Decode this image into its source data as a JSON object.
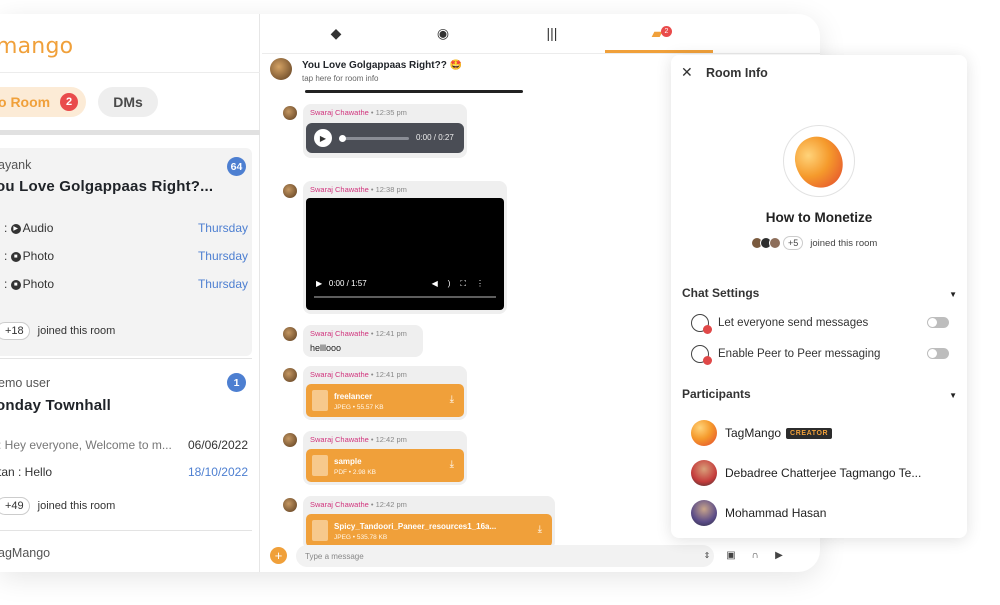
{
  "brand": {
    "logo_text": "mango"
  },
  "tabs": {
    "room_label": "o Room",
    "room_badge": "2",
    "dm_label": "DMs"
  },
  "top_nav": {
    "notification_count": "2"
  },
  "rooms": [
    {
      "sender": "ayank",
      "title": "ou Love Golgappaas Right?...",
      "unread": "64",
      "items": [
        {
          "prefix": "j : ",
          "type": "Audio",
          "date": "Thursday"
        },
        {
          "prefix": "j : ",
          "type": "Photo",
          "date": "Thursday"
        },
        {
          "prefix": "j : ",
          "type": "Photo",
          "date": "Thursday"
        }
      ],
      "joined_count": "+18",
      "joined_text": "joined this room"
    },
    {
      "sender": "emo user",
      "title": "onday Townhall",
      "unread": "1",
      "items": [
        {
          "text": ": Hey everyone, Welcome to m...",
          "date": "06/06/2022"
        },
        {
          "text": "tan : Hello",
          "date": "18/10/2022"
        }
      ],
      "joined_count": "+49",
      "joined_text": "joined this room"
    },
    {
      "sender": "agMango"
    }
  ],
  "chat": {
    "title": "You Love Golgappaas Right??",
    "title_emoji": "🤩",
    "subtitle": "tap here for room info",
    "messages": [
      {
        "sender": "Swaraj Chawathe",
        "time": "12:35 pm",
        "kind": "audio",
        "audio_time": "0:00 / 0:27"
      },
      {
        "sender": "Swaraj Chawathe",
        "time": "12:38 pm",
        "kind": "video",
        "video_time": "0:00 / 1:57"
      },
      {
        "sender": "Swaraj Chawathe",
        "time": "12:41 pm",
        "kind": "text",
        "text": "helllooo"
      },
      {
        "sender": "Swaraj Chawathe",
        "time": "12:41 pm",
        "kind": "file",
        "file_name": "freelancer",
        "file_meta": "JPEG  •  55.57 KB"
      },
      {
        "sender": "Swaraj Chawathe",
        "time": "12:42 pm",
        "kind": "file",
        "file_name": "sample",
        "file_meta": "PDF  •  2.98 KB"
      },
      {
        "sender": "Swaraj Chawathe",
        "time": "12:42 pm",
        "kind": "file",
        "file_name": "Spicy_Tandoori_Paneer_resources1_16a...",
        "file_meta": "JPEG  •  535.78 KB"
      }
    ],
    "input_placeholder": "Type a message"
  },
  "room_info": {
    "header": "Room Info",
    "room_name": "How to Monetize",
    "joined_count": "+5",
    "joined_text": "joined this room",
    "settings_title": "Chat Settings",
    "settings": [
      {
        "label": "Let everyone send messages",
        "enabled": false
      },
      {
        "label": "Enable Peer to Peer messaging",
        "enabled": false
      }
    ],
    "participants_title": "Participants",
    "participants": [
      {
        "name": "TagMango",
        "badge": "CREATOR"
      },
      {
        "name": "Debadree Chatterjee Tagmango Te..."
      },
      {
        "name": "Mohammad Hasan"
      }
    ]
  },
  "colors": {
    "brand_orange": "#f0a03a",
    "badge_red": "#e94b4b",
    "unread_blue": "#4d7fd1",
    "sender_pink": "#d1347d"
  }
}
